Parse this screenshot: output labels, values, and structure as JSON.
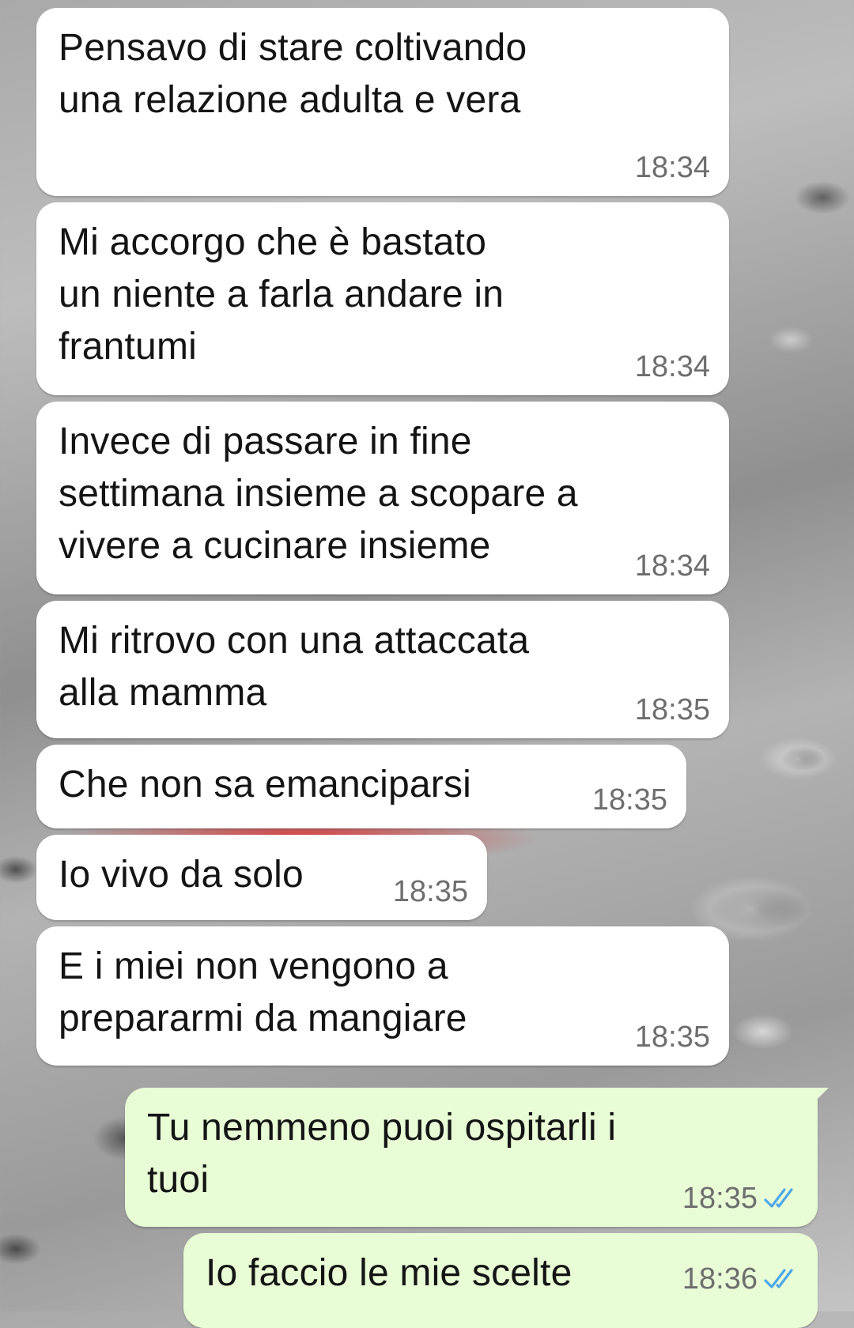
{
  "messages": [
    {
      "text": "Pensavo di stare coltivando\nuna relazione adulta e vera",
      "time": "18:34",
      "direction": "incoming"
    },
    {
      "text": "Mi accorgo che è bastato\nun niente a farla andare in\nfrantumi",
      "time": "18:34",
      "direction": "incoming"
    },
    {
      "text": "Invece di passare in fine\nsettimana insieme a scopare a\nvivere a cucinare insieme",
      "time": "18:34",
      "direction": "incoming"
    },
    {
      "text": "Mi ritrovo con una attaccata\nalla mamma",
      "time": "18:35",
      "direction": "incoming"
    },
    {
      "text": "Che non sa emanciparsi",
      "time": "18:35",
      "direction": "incoming"
    },
    {
      "text": "Io vivo da solo",
      "time": "18:35",
      "direction": "incoming"
    },
    {
      "text": "E i miei non vengono a\nprepararmi da mangiare",
      "time": "18:35",
      "direction": "incoming"
    },
    {
      "text": "Tu nemmeno puoi ospitarli i\ntuoi",
      "time": "18:35",
      "direction": "outgoing",
      "status_icon": "double-check-read-icon"
    },
    {
      "text": "Io faccio le mie scelte",
      "time": "18:36",
      "direction": "outgoing",
      "status_icon": "double-check-read-icon"
    }
  ],
  "colors": {
    "incoming_bubble": "#ffffff",
    "outgoing_bubble": "#e8fcd6",
    "read_tick": "#4fa8e8",
    "timestamp": "#6e6e6e"
  }
}
